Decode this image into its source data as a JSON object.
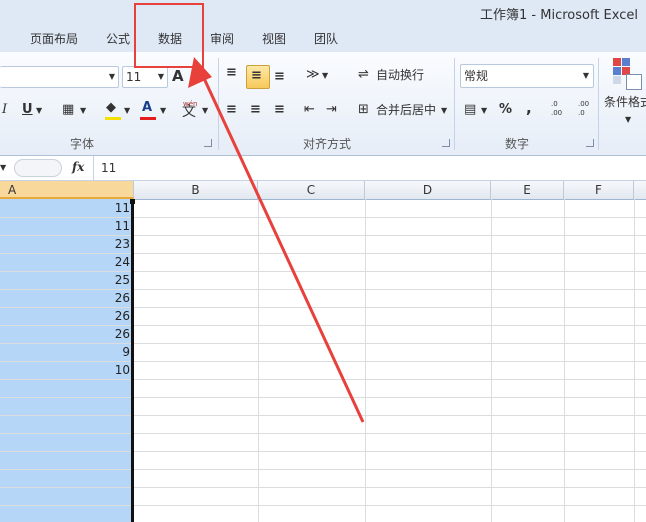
{
  "window": {
    "title": "工作簿1  -  Microsoft Excel"
  },
  "tabs": [
    {
      "label": "页面布局"
    },
    {
      "label": "公式"
    },
    {
      "label": "数据"
    },
    {
      "label": "审阅"
    },
    {
      "label": "视图"
    },
    {
      "label": "团队"
    }
  ],
  "ribbon": {
    "font_group": {
      "label": "字体",
      "font_size": "11",
      "grow_font": "A",
      "bold": "I",
      "underline": "U",
      "phonetic_top": "wén",
      "phonetic_bottom": "文"
    },
    "alignment_group": {
      "label": "对齐方式",
      "wrap_text": "自动换行",
      "merge_center": "合并后居中"
    },
    "number_group": {
      "label": "数字",
      "format": "常规",
      "percent": "%",
      "comma": ",",
      "dec_inc": ".0 .00",
      "dec_dec": ".00 .0"
    },
    "styles_group": {
      "conditional_format": "条件格式"
    }
  },
  "formula_bar": {
    "fx": "fx",
    "value": "11"
  },
  "columns": [
    "A",
    "B",
    "C",
    "D",
    "E",
    "F"
  ],
  "cells_a": [
    "11",
    "11",
    "23",
    "24",
    "25",
    "26",
    "26",
    "26",
    "9",
    "10"
  ],
  "colors": {
    "highlight_box": "#e8413c",
    "arrow": "#e8413c",
    "selection": "#b6d6f7"
  }
}
